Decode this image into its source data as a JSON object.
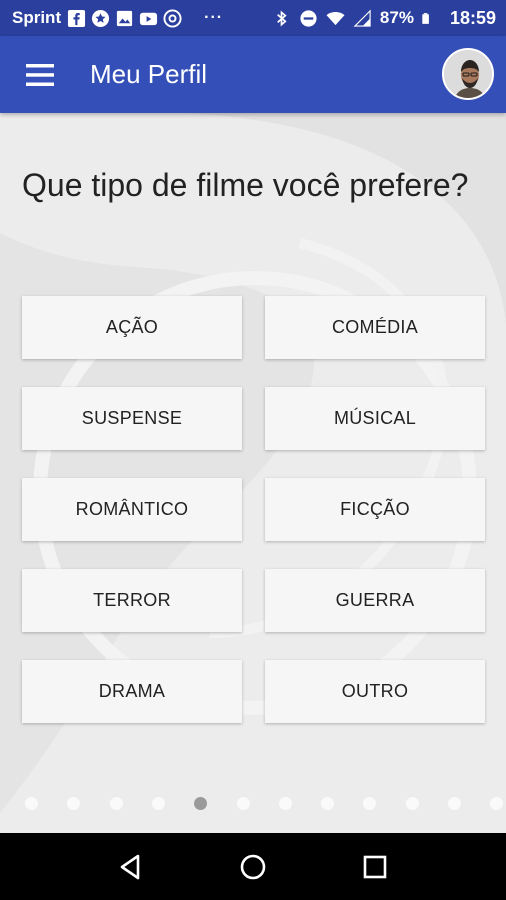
{
  "status_bar": {
    "carrier": "Sprint",
    "more": "···",
    "battery": "87%",
    "time": "18:59",
    "icons": [
      "facebook-icon",
      "star-badge-icon",
      "image-icon",
      "youtube-icon",
      "at-sign-icon",
      "bluetooth-icon",
      "do-not-disturb-icon",
      "wifi-icon",
      "signal-icon",
      "battery-icon"
    ]
  },
  "app_bar": {
    "title": "Meu Perfil",
    "menu_icon": "hamburger-menu-icon",
    "avatar": "user-avatar"
  },
  "main": {
    "question": "Que tipo de filme você prefere?",
    "options": [
      {
        "label": "AÇÃO"
      },
      {
        "label": "COMÉDIA"
      },
      {
        "label": "SUSPENSE"
      },
      {
        "label": "MÚSICAL"
      },
      {
        "label": "ROMÂNTICO"
      },
      {
        "label": "FICÇÃO"
      },
      {
        "label": "TERROR"
      },
      {
        "label": "GUERRA"
      },
      {
        "label": "DRAMA"
      },
      {
        "label": "OUTRO"
      }
    ]
  },
  "pager": {
    "total_visible": 12,
    "active_index": 4
  },
  "nav_bar": {
    "buttons": [
      "back-icon",
      "home-icon",
      "recents-icon"
    ]
  },
  "colors": {
    "status_bar": "#2b3f9e",
    "app_bar": "#3450b8",
    "background": "#ececec",
    "option_bg": "#f6f6f6"
  }
}
